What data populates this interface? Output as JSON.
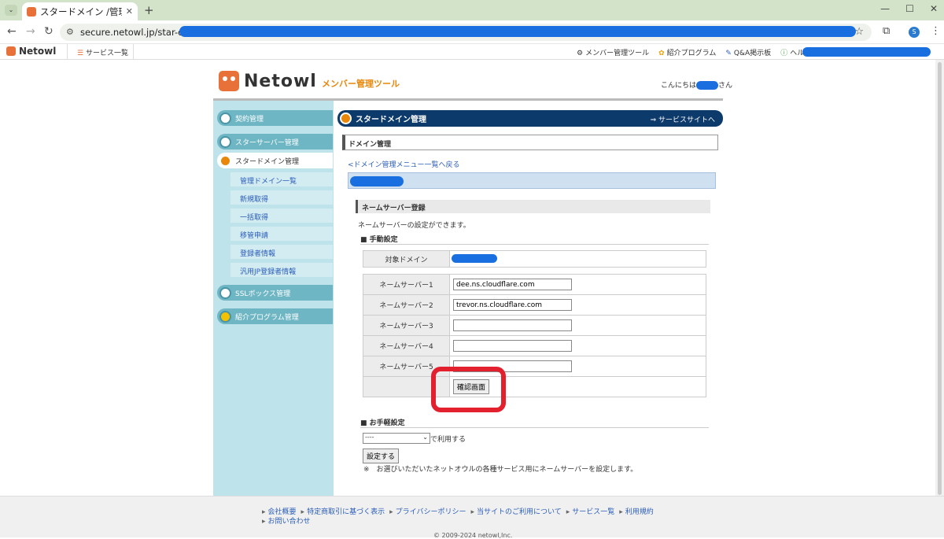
{
  "browser": {
    "tab_title": "スタードメイン /管理ツ",
    "url": "secure.netowl.jp/star-domain/"
  },
  "topnav": {
    "logo": "Netowl",
    "services": "サービス一覧",
    "links": [
      {
        "icon": "⚙",
        "label": "メンバー管理ツール"
      },
      {
        "icon": "✿",
        "label": "紹介プログラム"
      },
      {
        "icon": "✎",
        "label": "Q&A掲示板"
      },
      {
        "icon": "ⓘ",
        "label": "ヘルプ"
      }
    ]
  },
  "header": {
    "logo": "Netowl",
    "tool": "メンバー管理ツール",
    "greet_prefix": "こんにちは",
    "greet_suffix": "さん"
  },
  "sidebar": {
    "items": [
      {
        "label": "契約管理"
      },
      {
        "label": "スターサーバー管理"
      },
      {
        "label": "スタードメイン管理"
      },
      {
        "label": "SSLボックス管理"
      },
      {
        "label": "紹介プログラム管理"
      }
    ],
    "sub": [
      "管理ドメイン一覧",
      "新規取得",
      "一括取得",
      "移管申請",
      "登録者情報",
      "汎用JP登録者情報"
    ]
  },
  "main": {
    "title": "スタードメイン管理",
    "service_link": "⇒ サービスサイトへ",
    "section": "ドメイン管理",
    "back": "<ドメイン管理メニュー一覧へ戻る",
    "ns_heading": "ネームサーバー登録",
    "ns_desc": "ネームサーバーの設定ができます。",
    "manual": "■ 手動設定",
    "target_label": "対象ドメイン",
    "ns_labels": [
      "ネームサーバー1",
      "ネームサーバー2",
      "ネームサーバー3",
      "ネームサーバー4",
      "ネームサーバー5"
    ],
    "ns_values": [
      "dee.ns.cloudflare.com",
      "trevor.ns.cloudflare.com",
      "",
      "",
      ""
    ],
    "confirm": "確認画面",
    "easy": "■ お手軽設定",
    "select_value": "----",
    "select_suffix": "で利用する",
    "set_button": "設定する",
    "note": "※　お選びいただいたネットオウルの各種サービス用にネームサーバーを設定します。"
  },
  "footer": {
    "links": [
      "会社概要",
      "特定商取引に基づく表示",
      "プライバシーポリシー",
      "当サイトのご利用について",
      "サービス一覧",
      "利用規約",
      "お問い合わせ"
    ],
    "copyright": "© 2009-2024 netowl,Inc."
  }
}
